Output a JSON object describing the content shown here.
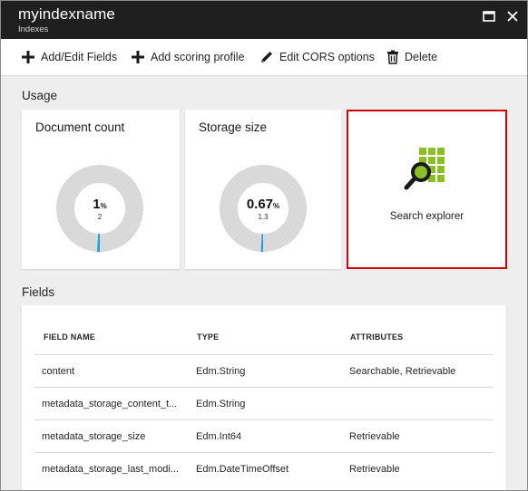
{
  "header": {
    "title": "myindexname",
    "subtitle": "Indexes",
    "maximize_icon": "maximize-icon",
    "close_icon": "close-icon"
  },
  "toolbar": {
    "items": [
      {
        "label": "Add/Edit Fields",
        "icon": "plus-icon"
      },
      {
        "label": "Add scoring profile",
        "icon": "plus-icon"
      },
      {
        "label": "Edit CORS options",
        "icon": "pencil-icon"
      },
      {
        "label": "Delete",
        "icon": "trash-icon"
      }
    ]
  },
  "usage": {
    "label": "Usage",
    "tiles": [
      {
        "title": "Document count",
        "value": "1",
        "unit": "%",
        "sub": "2",
        "fraction": 0.01
      },
      {
        "title": "Storage size",
        "value": "0.67",
        "unit": "%",
        "sub": "1.3",
        "fraction": 0.0067
      }
    ],
    "search_explorer": {
      "label": "Search explorer",
      "icon": "search-explorer-icon"
    }
  },
  "fields": {
    "label": "Fields",
    "columns": [
      "FIELD NAME",
      "TYPE",
      "ATTRIBUTES"
    ],
    "rows": [
      {
        "name": "content",
        "type": "Edm.String",
        "attributes": "Searchable, Retrievable"
      },
      {
        "name": "metadata_storage_content_t...",
        "type": "Edm.String",
        "attributes": ""
      },
      {
        "name": "metadata_storage_size",
        "type": "Edm.Int64",
        "attributes": "Retrievable"
      },
      {
        "name": "metadata_storage_last_modi...",
        "type": "Edm.DateTimeOffset",
        "attributes": "Retrievable"
      }
    ]
  },
  "colors": {
    "header_bg": "#1f1f1f",
    "accent": "#1ba1e2",
    "highlight_border": "#d40000",
    "search_icon_green": "#8cbf26"
  }
}
